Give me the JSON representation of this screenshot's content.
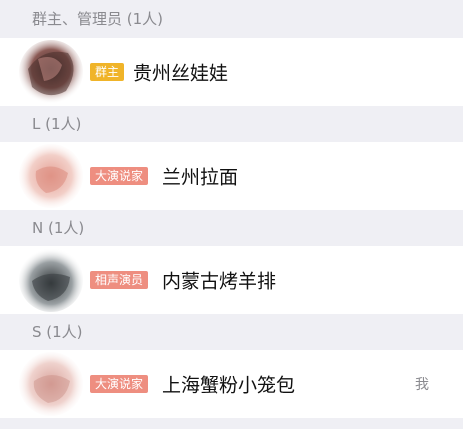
{
  "sections": [
    {
      "header": "群主、管理员 (1人)",
      "member": {
        "badge": "群主",
        "badge_color": "#f0b429",
        "name": "贵州丝娃娃",
        "avatar_icon": "avatar-image"
      }
    },
    {
      "header": "L (1人)",
      "member": {
        "badge": "大演说家",
        "badge_color": "#ee8e80",
        "name": "兰州拉面",
        "avatar_icon": "avatar-image"
      }
    },
    {
      "header": "N (1人)",
      "member": {
        "badge": "相声演员",
        "badge_color": "#ee8e80",
        "name": "内蒙古烤羊排",
        "avatar_icon": "avatar-image"
      }
    },
    {
      "header": "S (1人)",
      "member": {
        "badge": "大演说家",
        "badge_color": "#ee8e80",
        "name": "上海蟹粉小笼包",
        "avatar_icon": "avatar-image",
        "me_label": "我"
      }
    }
  ]
}
